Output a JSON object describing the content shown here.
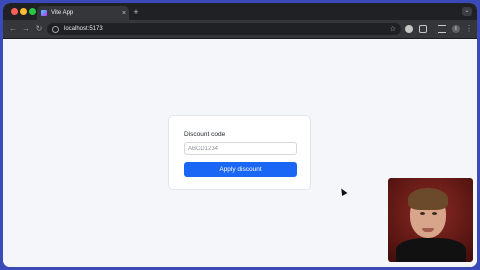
{
  "browser": {
    "tab_title": "Vite App",
    "tab_close": "×",
    "new_tab": "+",
    "tab_menu": "⌄",
    "url": "localhost:5173",
    "nav": {
      "back": "←",
      "forward": "→",
      "reload": "↻"
    },
    "star": "☆",
    "menu": "⋮",
    "profile_initial": "I"
  },
  "form": {
    "label": "Discount code",
    "input_placeholder": "ABCD1234",
    "input_value": "",
    "button_label": "Apply discount"
  },
  "colors": {
    "accent": "#1a66f5",
    "page_background": "#f5f6f9",
    "frame_background": "#3a4ab8"
  }
}
